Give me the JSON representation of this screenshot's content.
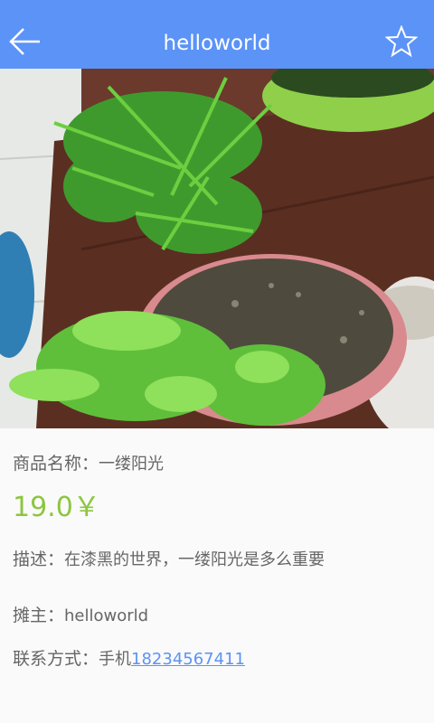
{
  "header": {
    "title": "helloworld",
    "back_icon": "arrow-left-icon",
    "favorite_icon": "star-outline-icon",
    "bg": "#5b93f7"
  },
  "product": {
    "name_label": "商品名称：",
    "name": "一缕阳光",
    "price": "19.0￥",
    "desc_label": "描述：",
    "desc": "在漆黑的世界，一缕阳光是多么重要",
    "seller_label": "摊主：",
    "seller": "helloworld",
    "contact_label": "联系方式：",
    "contact_prefix": "手机",
    "phone": "18234567411",
    "price_color": "#8cc63f",
    "link_color": "#5b93f7"
  }
}
